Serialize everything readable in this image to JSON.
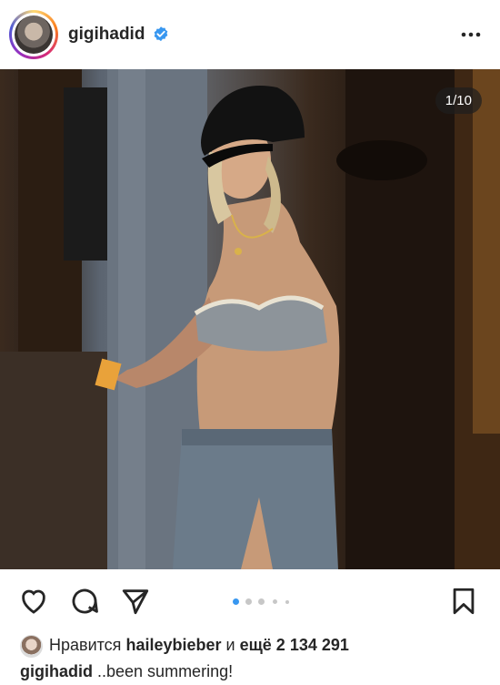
{
  "post": {
    "username": "gigihadid",
    "verified": true,
    "image": {
      "counter": "1/10",
      "alt_icon": "photo"
    },
    "carousel": {
      "count": 5,
      "active": 0
    },
    "likes": {
      "prefix": "Нравится",
      "user": "haileybieber",
      "conj": "и",
      "more": "ещё 2 134 291"
    },
    "caption": {
      "user": "gigihadid",
      "text": "..been summering!"
    }
  },
  "colors": {
    "verified_blue": "#3897f0",
    "active_dot": "#3897f0",
    "inactive_dot": "#c7c7c7"
  }
}
